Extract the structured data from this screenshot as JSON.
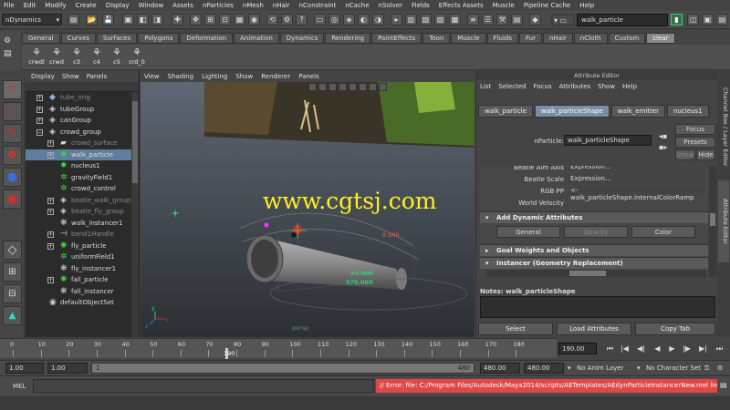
{
  "menubar": [
    "File",
    "Edit",
    "Modify",
    "Create",
    "Display",
    "Window",
    "Assets",
    "nParticles",
    "nMesh",
    "nHair",
    "nConstraint",
    "nCache",
    "nSolver",
    "Fields",
    "Effects Assets",
    "Muscle",
    "Pipeline Cache",
    "Help"
  ],
  "status": {
    "mode": "nDynamics",
    "selection_field": "walk_particle"
  },
  "shelf": {
    "tabs": [
      "General",
      "Curves",
      "Surfaces",
      "Polygons",
      "Deformation",
      "Animation",
      "Dynamics",
      "Rendering",
      "PaintEffects",
      "Toon",
      "Muscle",
      "Fluids",
      "Fur",
      "nHair",
      "nCloth",
      "Custom",
      "clear"
    ],
    "active_tab": "clear",
    "items": [
      "crwdl",
      "crwd",
      "c3",
      "c4",
      "c5",
      "crd_0"
    ]
  },
  "outliner": {
    "menu": [
      "Display",
      "Show",
      "Panels"
    ],
    "rows": [
      {
        "name": "tube_orig",
        "dim": true,
        "indent": 0,
        "exp": "+",
        "icon": "cube-icon"
      },
      {
        "name": "tubeGroup",
        "dim": false,
        "indent": 0,
        "exp": "+",
        "icon": "group-icon"
      },
      {
        "name": "canGroup",
        "dim": false,
        "indent": 0,
        "exp": "+",
        "icon": "group-icon"
      },
      {
        "name": "crowd_group",
        "dim": false,
        "indent": 0,
        "exp": "−",
        "icon": "group-icon"
      },
      {
        "name": "crowd_surface",
        "dim": true,
        "indent": 1,
        "exp": "+",
        "icon": "surface-icon"
      },
      {
        "name": "walk_particle",
        "dim": false,
        "indent": 1,
        "exp": "+",
        "icon": "particle-icon",
        "selected": true
      },
      {
        "name": "nucleus1",
        "dim": false,
        "indent": 1,
        "exp": "",
        "icon": "nucleus-icon"
      },
      {
        "name": "gravityField1",
        "dim": false,
        "indent": 1,
        "exp": "",
        "icon": "field-icon"
      },
      {
        "name": "crowd_control",
        "dim": false,
        "indent": 1,
        "exp": "",
        "icon": "control-icon"
      },
      {
        "name": "beatle_walk_group",
        "dim": true,
        "indent": 1,
        "exp": "+",
        "icon": "group-icon"
      },
      {
        "name": "beatle_fly_group",
        "dim": true,
        "indent": 1,
        "exp": "+",
        "icon": "group-icon"
      },
      {
        "name": "walk_instancer1",
        "dim": false,
        "indent": 1,
        "exp": "",
        "icon": "instancer-icon"
      },
      {
        "name": "bend1Handle",
        "dim": true,
        "indent": 1,
        "exp": "+",
        "icon": "handle-icon"
      },
      {
        "name": "fly_particle",
        "dim": false,
        "indent": 1,
        "exp": "+",
        "icon": "particle-icon"
      },
      {
        "name": "uniformField1",
        "dim": false,
        "indent": 1,
        "exp": "",
        "icon": "field-icon"
      },
      {
        "name": "fly_instancer1",
        "dim": false,
        "indent": 1,
        "exp": "",
        "icon": "instancer-icon"
      },
      {
        "name": "fall_particle",
        "dim": false,
        "indent": 1,
        "exp": "+",
        "icon": "particle-icon"
      },
      {
        "name": "fall_instancer",
        "dim": false,
        "indent": 1,
        "exp": "",
        "icon": "instancer-icon"
      },
      {
        "name": "defaultObjectSet",
        "dim": false,
        "indent": 0,
        "exp": "",
        "icon": "set-icon"
      }
    ]
  },
  "viewport": {
    "menu": [
      "View",
      "Shading",
      "Lighting",
      "Show",
      "Renderer",
      "Panels"
    ],
    "watermark": "www.cgtsj.com",
    "label_value1": "0.000",
    "label_value2": "50.000",
    "label_value3": "570.000",
    "camera_label": "persp",
    "axis_x": "x",
    "axis_y": "y",
    "axis_z": "z"
  },
  "attr_editor": {
    "title": "Attribute Editor",
    "menu": [
      "List",
      "Selected",
      "Focus",
      "Attributes",
      "Show",
      "Help"
    ],
    "tabs": [
      "walk_particle",
      "walk_particleShape",
      "walk_emitter",
      "nucleus1"
    ],
    "active_tab": "walk_particleShape",
    "node_label": "nParticle:",
    "node_value": "walk_particleShape",
    "buttons": {
      "focus": "Focus",
      "presets": "Presets",
      "show": "Show",
      "hide": "Hide"
    },
    "attrs": [
      {
        "label": "Beatle Aim Axis",
        "value": "Expression..."
      },
      {
        "label": "Beatle Scale",
        "value": "Expression..."
      },
      {
        "label": "RGB PP",
        "value": "<- walk_particleShape.internalColorRamp"
      },
      {
        "label": "World Velocity",
        "value": ""
      }
    ],
    "sections": {
      "add_dynamic": "Add Dynamic Attributes",
      "goal": "Goal Weights and Objects",
      "instancer": "Instancer (Geometry Replacement)"
    },
    "dyn_buttons": {
      "general": "General",
      "opacity": "Opacity",
      "color": "Color"
    },
    "notes_label": "Notes: walk_particleShape",
    "bottom_buttons": {
      "select": "Select",
      "load": "Load Attributes",
      "copy": "Copy Tab"
    }
  },
  "side_tabs": [
    "Channel Box / Layer Editor",
    "Attribute Editor"
  ],
  "timeline": {
    "ticks": [
      "0",
      "10",
      "20",
      "30",
      "40",
      "50",
      "60",
      "70",
      "80",
      "90",
      "100",
      "110",
      "120",
      "130",
      "140",
      "150",
      "160",
      "170",
      "180"
    ],
    "current_label": "190",
    "current_frame": "190.00"
  },
  "range": {
    "start": "1.00",
    "anim_start": "1.00",
    "bar_start": "1",
    "bar_end": "480",
    "anim_end": "480.00",
    "end": "480.00",
    "anim_layer": "No Anim Layer",
    "char_set": "No Character Set"
  },
  "cmdline": {
    "label": "MEL",
    "error": "// Error: file: C:/Program Files/Autodesk/Maya2014/scripts/AETemplates/AEdynParticleInstancerNew.mel line 491: Could no"
  },
  "colors": {
    "watermark": "#ffee22",
    "selected_row": "#5f7e9b",
    "error_bg": "#e04848",
    "accent_green": "#2fd77a"
  }
}
